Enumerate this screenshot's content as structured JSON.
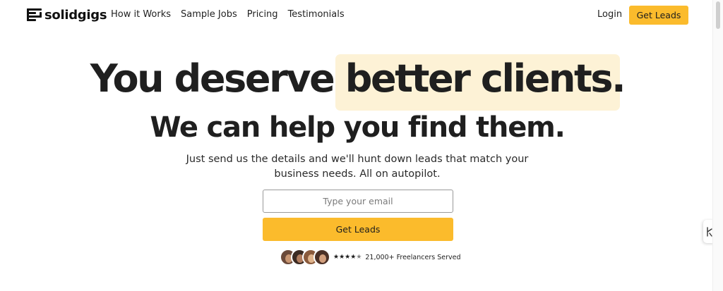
{
  "brand": {
    "name": "solidgigs"
  },
  "nav": {
    "links": [
      {
        "label": "How it Works"
      },
      {
        "label": "Sample Jobs"
      },
      {
        "label": "Pricing"
      },
      {
        "label": "Testimonials"
      }
    ],
    "login_label": "Login",
    "cta_label": "Get Leads"
  },
  "hero": {
    "headline_part1": "You deserve ",
    "headline_highlight": "better clients.",
    "headline_line2": "We can help you find them.",
    "subtext": "Just send us the details and we'll hunt down leads that match your business needs. All on autopilot.",
    "email_placeholder": "Type your email",
    "cta_label": "Get Leads"
  },
  "social_proof": {
    "rating": 4.5,
    "text": "21,000+ Freelancers Served"
  },
  "colors": {
    "accent": "#fbbb2c",
    "highlight": "#fdf2d6",
    "text": "#1f1f1f"
  },
  "icons": {
    "logo": "solidgigs-logo-icon",
    "side_widget": "accessibility-widget-icon"
  }
}
